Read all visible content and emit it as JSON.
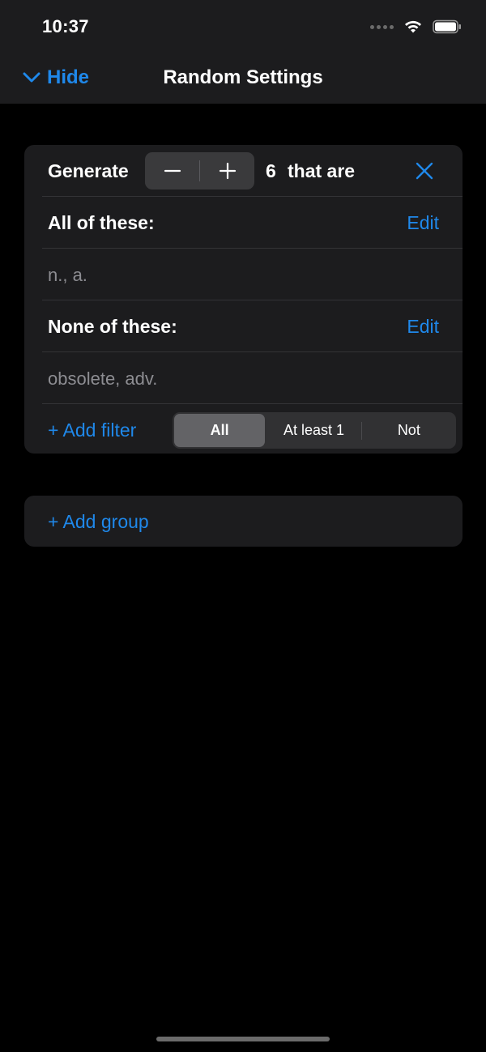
{
  "status_bar": {
    "time": "10:37",
    "icons": [
      "signal-dots-icon",
      "wifi-icon",
      "battery-icon"
    ]
  },
  "nav": {
    "back_label": "Hide",
    "back_icon": "chevron-down-icon",
    "title": "Random Settings"
  },
  "group": {
    "generate_label": "Generate",
    "count": "6",
    "that_are_label": "that are",
    "decrement_icon": "minus-icon",
    "increment_icon": "plus-icon",
    "close_icon": "close-icon",
    "all_of_label": "All of these:",
    "all_of_edit": "Edit",
    "all_of_values": "n., a.",
    "none_of_label": "None of these:",
    "none_of_edit": "Edit",
    "none_of_values": "obsolete, adv.",
    "add_filter_label": "+ Add filter",
    "segments": [
      "All",
      "At least 1",
      "Not"
    ],
    "selected_segment": "All"
  },
  "add_group_label": "+ Add group",
  "colors": {
    "accent": "#1f88ea",
    "background": "#000000",
    "card": "#1c1c1e",
    "secondary_text": "#8d8d92",
    "segment_selected": "#636366"
  }
}
